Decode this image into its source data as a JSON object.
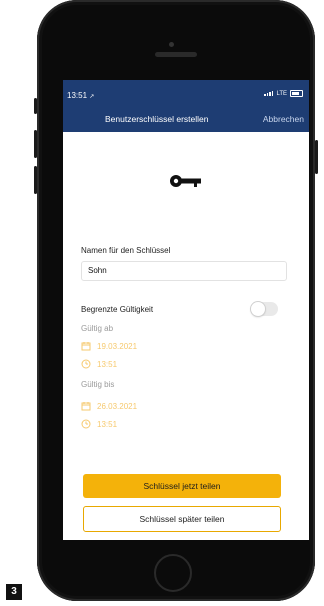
{
  "status": {
    "time": "13:51",
    "network": "LTE"
  },
  "header": {
    "title": "Benutzerschlüssel erstellen",
    "cancel_label": "Abbrechen"
  },
  "form": {
    "name_label": "Namen für den Schlüssel",
    "name_value": "Sohn",
    "limited_validity_label": "Begrenzte Gültigkeit",
    "limited_validity_on": false,
    "valid_from_label": "Gültig ab",
    "valid_from_date": "19.03.2021",
    "valid_from_time": "13:51",
    "valid_until_label": "Gültig bis",
    "valid_until_date": "26.03.2021",
    "valid_until_time": "13:51"
  },
  "buttons": {
    "share_now": "Schlüssel jetzt teilen",
    "share_later": "Schlüssel später teilen"
  },
  "figure_number": "3",
  "colors": {
    "header": "#1e3d73",
    "accent": "#f4b20a",
    "icon_muted": "#f6c96e"
  },
  "icons": [
    "location-arrow-icon",
    "signal-icon",
    "battery-icon",
    "key-icon",
    "calendar-icon",
    "clock-icon"
  ]
}
